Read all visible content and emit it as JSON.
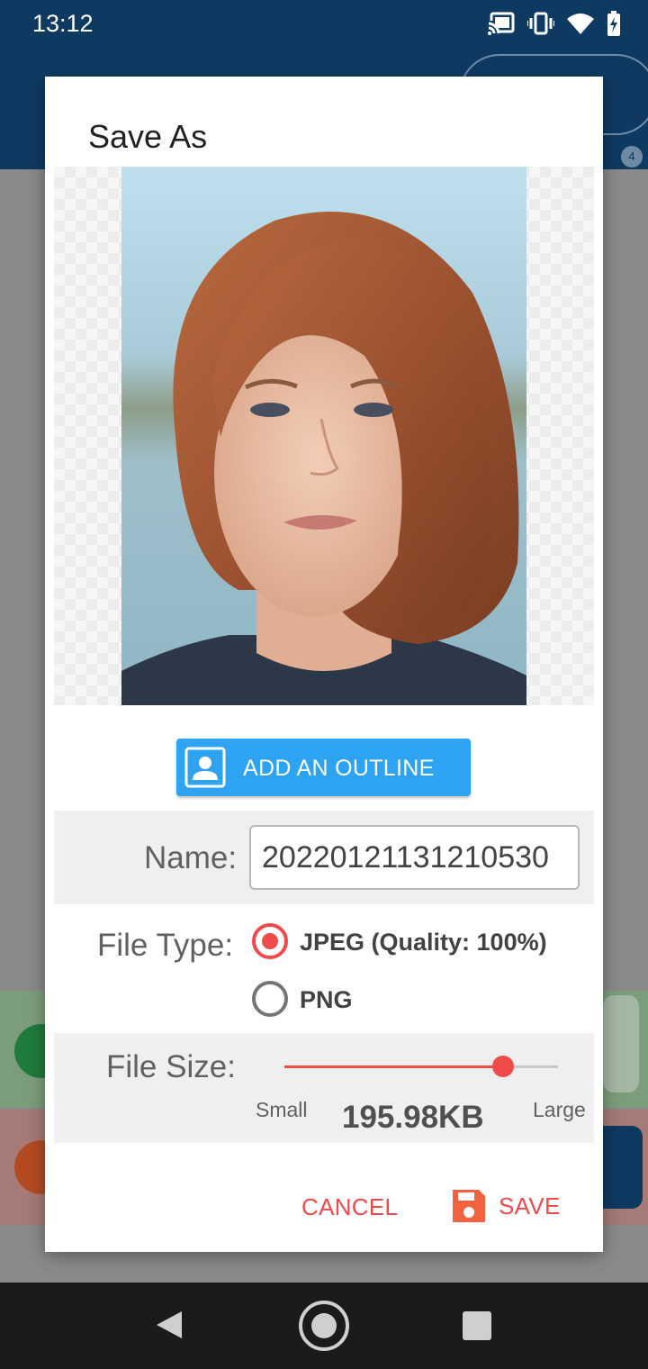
{
  "status_bar": {
    "time": "13:12",
    "icons": [
      "cast-icon",
      "vibrate-icon",
      "wifi-icon",
      "battery-charging-icon"
    ]
  },
  "background_app": {
    "badge": "4"
  },
  "dialog": {
    "title": "Save As",
    "outline_button": {
      "label": "ADD AN OUTLINE",
      "icon": "portrait-icon"
    },
    "name": {
      "label": "Name:",
      "value": "20220121131210530"
    },
    "file_type": {
      "label": "File Type:",
      "options": [
        {
          "label": "JPEG (Quality: 100%)",
          "selected": true
        },
        {
          "label": "PNG",
          "selected": false
        }
      ]
    },
    "file_size": {
      "label": "File Size:",
      "min_label": "Small",
      "max_label": "Large",
      "value": "195.98KB",
      "slider_fraction": 0.8
    },
    "actions": {
      "cancel_label": "CANCEL",
      "save_label": "SAVE",
      "save_icon": "floppy-disk-icon"
    }
  },
  "colors": {
    "accent": "#ef4b4b",
    "outline_button": "#2ea3f2",
    "app_bar": "#0e3a62"
  }
}
